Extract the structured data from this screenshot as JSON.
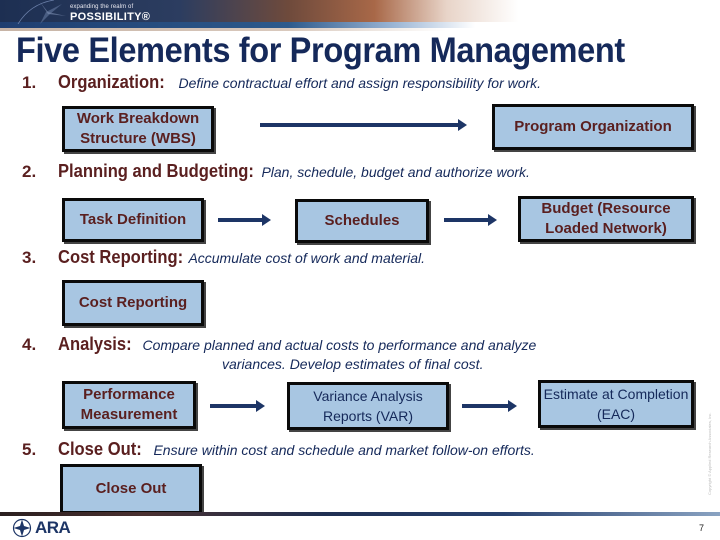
{
  "header": {
    "tagline_small": "expanding the realm of",
    "tagline_big": "POSSIBILITY®"
  },
  "title": "Five Elements for Program Management",
  "steps": [
    {
      "number": "1.",
      "name": "Organization:",
      "description": "Define contractual effort and assign responsibility for work.",
      "boxes": [
        "Work Breakdown Structure (WBS)",
        "Program Organization"
      ]
    },
    {
      "number": "2.",
      "name": "Planning and Budgeting:",
      "description": "Plan, schedule, budget and authorize work.",
      "boxes": [
        "Task Definition",
        "Schedules",
        "Budget (Resource Loaded Network)"
      ]
    },
    {
      "number": "3.",
      "name": "Cost Reporting:",
      "description": "Accumulate cost of work and material.",
      "boxes": [
        "Cost Reporting"
      ]
    },
    {
      "number": "4.",
      "name": "Analysis:",
      "description": "Compare planned and actual costs to performance and analyze",
      "description_line2": "variances. Develop estimates of final cost.",
      "boxes": [
        "Performance Measurement",
        "Variance Analysis Reports (VAR)",
        "Estimate at Completion (EAC)"
      ]
    },
    {
      "number": "5.",
      "name": "Close Out:",
      "description": "Ensure within cost and schedule and market follow-on efforts.",
      "boxes": [
        "Close Out"
      ]
    }
  ],
  "footer": {
    "logo_text": "ARA",
    "page_number": "7",
    "copyright": "Copyright © Applied Research Associates, Inc."
  }
}
